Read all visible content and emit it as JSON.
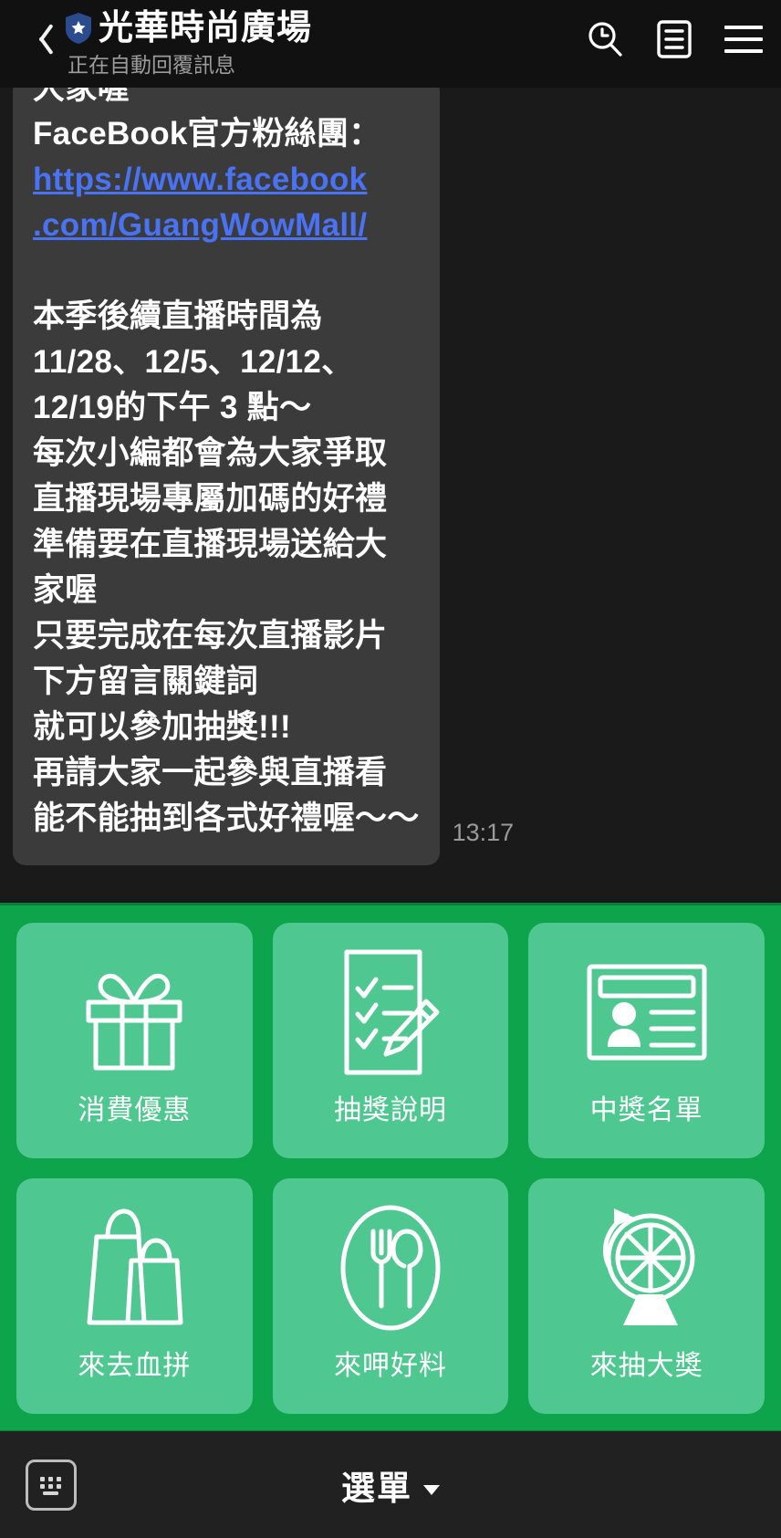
{
  "header": {
    "back_icon": "back-chevron-icon",
    "badge_icon": "verified-shield-star-icon",
    "title": "光華時尚廣場",
    "subtitle": "正在自動回覆訊息",
    "actions": [
      {
        "name": "search-history-icon",
        "label": "搜尋"
      },
      {
        "name": "note-icon",
        "label": "記事本"
      },
      {
        "name": "hamburger-menu-icon",
        "label": "選單"
      }
    ]
  },
  "chat": {
    "message": {
      "lines": [
        "大家喔",
        "FaceBook官方粉絲團：",
        "",
        "本季後續直播時間為",
        "11/28、12/5、12/12、",
        "12/19的下午 3 點～",
        "每次小編都會為大家爭取",
        "直播現場專屬加碼的好禮",
        "準備要在直播現場送給大",
        "家喔",
        "只要完成在每次直播影片",
        "下方留言關鍵詞",
        "就可以參加抽獎!!!",
        "再請大家一起參與直播看",
        "能不能抽到各式好禮喔～～"
      ],
      "link_text": "https://www.facebook.com/GuangWowMall/",
      "link_line_1": "https://www.facebook",
      "link_line_2": ".com/GuangWowMall/",
      "timestamp": "13:17"
    }
  },
  "rich_menu": {
    "background_color": "#0ea44c",
    "card_color": "#4fc790",
    "rows": [
      [
        {
          "icon": "gift-box-icon",
          "label": "消費優惠"
        },
        {
          "icon": "checklist-pencil-icon",
          "label": "抽獎說明"
        },
        {
          "icon": "id-card-icon",
          "label": "中獎名單"
        }
      ],
      [
        {
          "icon": "shopping-bags-icon",
          "label": "來去血拼"
        },
        {
          "icon": "fork-spoon-plate-icon",
          "label": "來呷好料"
        },
        {
          "icon": "prize-wheel-icon",
          "label": "來抽大獎"
        }
      ]
    ]
  },
  "bottom_bar": {
    "keyboard_icon": "keyboard-icon",
    "menu_label": "選單",
    "caret_icon": "caret-down-icon"
  }
}
